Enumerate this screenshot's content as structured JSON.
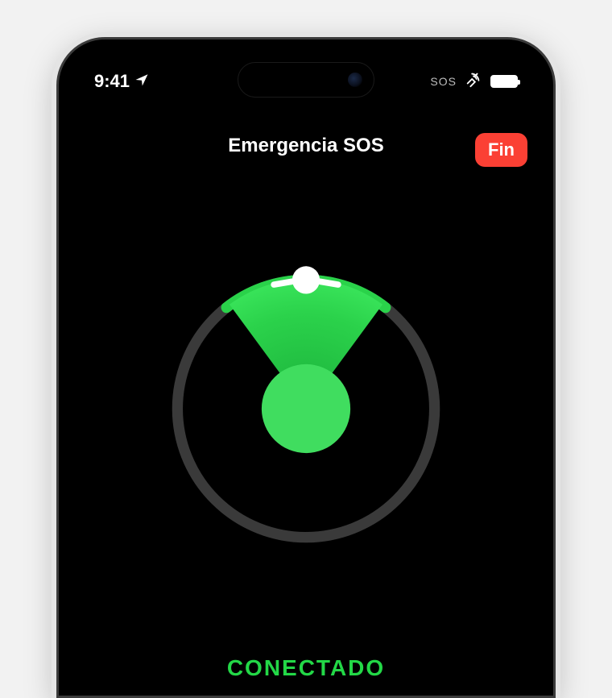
{
  "statusBar": {
    "time": "9:41",
    "sosLabel": "SOS"
  },
  "header": {
    "title": "Emergencia SOS",
    "endButtonLabel": "Fin"
  },
  "connection": {
    "statusLabel": "CONECTADO"
  },
  "colors": {
    "accentGreen": "#23d847",
    "endRed": "#fb4034"
  }
}
